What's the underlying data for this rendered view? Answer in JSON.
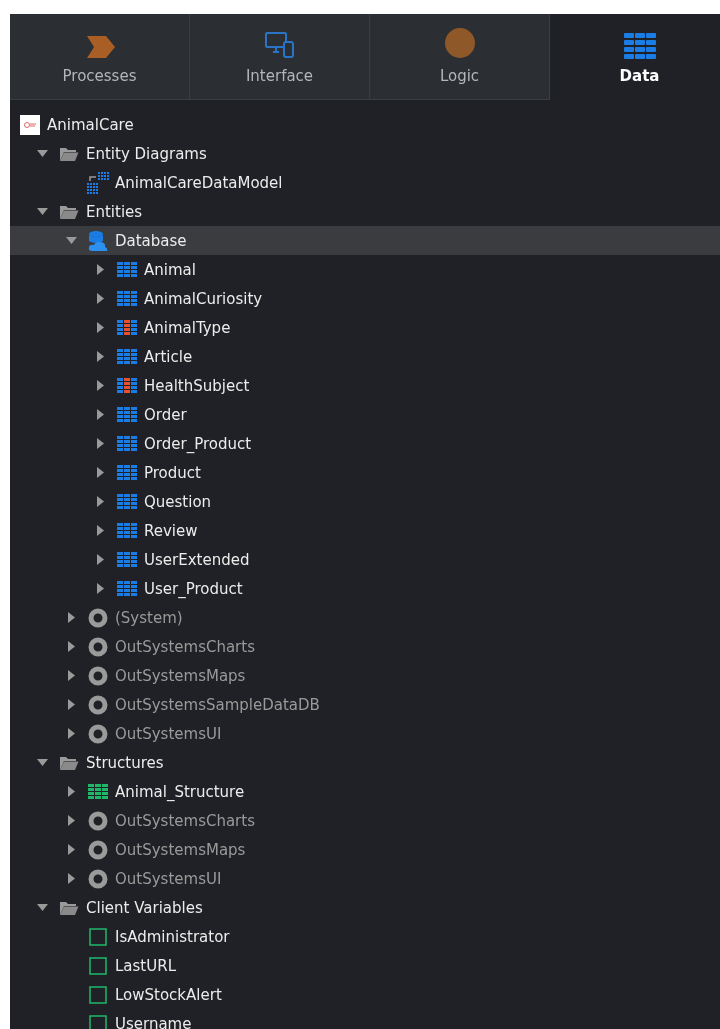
{
  "tabs": [
    {
      "label": "Processes",
      "kind": "processes",
      "selected": false
    },
    {
      "label": "Interface",
      "kind": "interface",
      "selected": false
    },
    {
      "label": "Logic",
      "kind": "logic",
      "selected": false
    },
    {
      "label": "Data",
      "kind": "data",
      "selected": true
    }
  ],
  "tree": [
    {
      "label": "AnimalCare",
      "kind": "app",
      "selected": false,
      "children": [
        {
          "label": "Entity Diagrams",
          "kind": "folder",
          "expanded": true,
          "selected": false,
          "children": [
            {
              "label": "AnimalCareDataModel",
              "kind": "diagram",
              "selected": false
            }
          ]
        },
        {
          "label": "Entities",
          "kind": "folder",
          "expanded": true,
          "selected": false,
          "children": [
            {
              "label": "Database",
              "kind": "database",
              "expanded": true,
              "selected": true,
              "children": [
                {
                  "label": "Animal",
                  "kind": "entity",
                  "expanded": false,
                  "selected": false
                },
                {
                  "label": "AnimalCuriosity",
                  "kind": "entity",
                  "expanded": false,
                  "selected": false
                },
                {
                  "label": "AnimalType",
                  "kind": "static-entity",
                  "expanded": false,
                  "selected": false
                },
                {
                  "label": "Article",
                  "kind": "entity",
                  "expanded": false,
                  "selected": false
                },
                {
                  "label": "HealthSubject",
                  "kind": "static-entity",
                  "expanded": false,
                  "selected": false
                },
                {
                  "label": "Order",
                  "kind": "entity",
                  "expanded": false,
                  "selected": false
                },
                {
                  "label": "Order_Product",
                  "kind": "entity",
                  "expanded": false,
                  "selected": false
                },
                {
                  "label": "Product",
                  "kind": "entity",
                  "expanded": false,
                  "selected": false
                },
                {
                  "label": "Question",
                  "kind": "entity",
                  "expanded": false,
                  "selected": false
                },
                {
                  "label": "Review",
                  "kind": "entity",
                  "expanded": false,
                  "selected": false
                },
                {
                  "label": "UserExtended",
                  "kind": "entity",
                  "expanded": false,
                  "selected": false
                },
                {
                  "label": "User_Product",
                  "kind": "entity",
                  "expanded": false,
                  "selected": false
                }
              ]
            },
            {
              "label": "(System)",
              "kind": "module",
              "expanded": false,
              "selected": false
            },
            {
              "label": "OutSystemsCharts",
              "kind": "module",
              "expanded": false,
              "selected": false
            },
            {
              "label": "OutSystemsMaps",
              "kind": "module",
              "expanded": false,
              "selected": false
            },
            {
              "label": "OutSystemsSampleDataDB",
              "kind": "module",
              "expanded": false,
              "selected": false
            },
            {
              "label": "OutSystemsUI",
              "kind": "module",
              "expanded": false,
              "selected": false
            }
          ]
        },
        {
          "label": "Structures",
          "kind": "folder",
          "expanded": true,
          "selected": false,
          "children": [
            {
              "label": "Animal_Structure",
              "kind": "structure",
              "expanded": false,
              "selected": false
            },
            {
              "label": "OutSystemsCharts",
              "kind": "module",
              "expanded": false,
              "selected": false
            },
            {
              "label": "OutSystemsMaps",
              "kind": "module",
              "expanded": false,
              "selected": false
            },
            {
              "label": "OutSystemsUI",
              "kind": "module",
              "expanded": false,
              "selected": false
            }
          ]
        },
        {
          "label": "Client Variables",
          "kind": "folder",
          "expanded": true,
          "selected": false,
          "children": [
            {
              "label": "IsAdministrator",
              "kind": "variable",
              "selected": false
            },
            {
              "label": "LastURL",
              "kind": "variable",
              "selected": false
            },
            {
              "label": "LowStockAlert",
              "kind": "variable",
              "selected": false
            },
            {
              "label": "Username",
              "kind": "variable",
              "selected": false
            }
          ]
        }
      ]
    }
  ]
}
